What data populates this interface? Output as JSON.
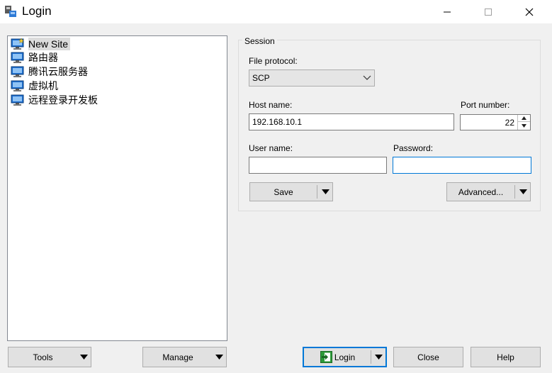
{
  "window": {
    "title": "Login"
  },
  "sites": [
    {
      "label": "New Site",
      "selected": true
    },
    {
      "label": "路由器"
    },
    {
      "label": "腾讯云服务器"
    },
    {
      "label": "虚拟机"
    },
    {
      "label": "远程登录开发板"
    }
  ],
  "session": {
    "group_label": "Session",
    "file_protocol_label": "File protocol:",
    "file_protocol_value": "SCP",
    "host_name_label": "Host name:",
    "host_name_value": "192.168.10.1",
    "port_label": "Port number:",
    "port_value": "22",
    "user_name_label": "User name:",
    "user_name_value": "",
    "password_label": "Password:",
    "password_value": "",
    "save_label": "Save",
    "advanced_label": "Advanced..."
  },
  "buttons": {
    "tools": "Tools",
    "manage": "Manage",
    "login": "Login",
    "close": "Close",
    "help": "Help"
  },
  "colors": {
    "accent": "#0078d7",
    "monitor": "#1e6fd0",
    "login_icon": "#2e9b3a"
  }
}
